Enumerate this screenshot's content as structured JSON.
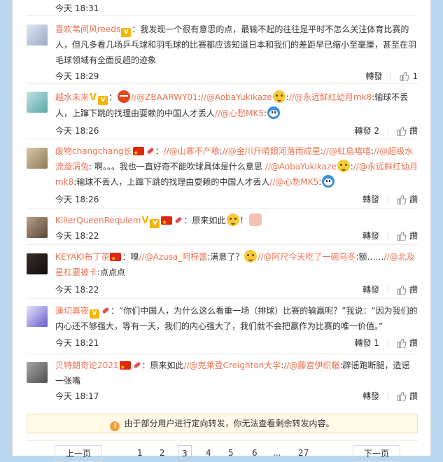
{
  "top": {
    "time": "今天 18:31"
  },
  "labels": {
    "repost": "轉發",
    "like_icon": "thumbs-up-icon"
  },
  "comments": [
    {
      "user": "喜欢苇间风reeds",
      "text": "：我发现一个很有意思的点，最输不起的往往是平时不怎么关注体育比赛的人，但凡多看几场乒乓球和羽毛球的比赛都应该知道日本和我们的差距早已缩小至毫厘，甚至在羽毛球领域有全面反超的迹象",
      "time": "今天 18:29",
      "repost": "轉發",
      "likes": "1"
    },
    {
      "user": "越水未来",
      "p1": "：",
      "m1": "//@ZBAARWY01",
      "p2": ":",
      "m2": "//@AobaYukikaze",
      "p3": ":",
      "m3": "//@永远鲜红幼月mk8",
      "p4": ":输球不丢人，上蹿下跳的找理由耍赖的中国人才丢人",
      "m4": "//@心愁MK5",
      "p5": ":",
      "time": "今天 18:26",
      "repost": "轉發 2",
      "likes": "讚"
    },
    {
      "user": "废物changchang长",
      "p1": "：",
      "m1": "//@山寨不产粮",
      "p2": ":",
      "m2": "//@金川升晴銀河落雨成星",
      "p3": ":",
      "m3": "//@虹島嘻嘻",
      "p4": ":",
      "m4": "//@超级水流漩涡兔",
      "p5": ": 啊。。。我也一直好奇不能吹球具体是什么意思 ",
      "m5": "//@AobaYukikaze",
      "p6": ":",
      "m6": "//@永远鲜红幼月mk8",
      "p7": ":输球不丢人，上蹿下跳的找理由耍赖的中国人才丢人",
      "m7": "//@心愁MK5",
      "p8": ":",
      "time": "今天 18:26",
      "repost": "轉發",
      "likes": "讚"
    },
    {
      "user": "KillerQueenRequiem",
      "text": "：原来如此",
      "tail": "！",
      "time": "今天 18:22",
      "repost": "轉發",
      "likes": "讚"
    },
    {
      "user": "KEYAKI布丁茶",
      "p1": "：嗅",
      "m1": "//@Azusa_阿梓蕾",
      "p2": ":满意了？",
      "m2": "//@阿尺今天吃了一碗乌冬",
      "p3": ":额……",
      "m3": "//@北及星杠要被卡",
      "p4": ":点点点",
      "time": "今天 18:22",
      "repost": "轉發",
      "likes": "讚"
    },
    {
      "user": "蓮切真夜",
      "text": "：“你们中国人，为什么这么看重一场（排球）比赛的输赢呢？”我说：“因为我们的内心还不够强大，等有一天，我们的内心强大了，我们就不会把赢作为比赛的唯一价值。”",
      "time": "今天 18:21",
      "repost": "轉發 1",
      "likes": "讚"
    },
    {
      "user": "贝特朗奇论2021",
      "p1": "：原来如此",
      "m1": "//@克莱登Creighton大学",
      "p2": ":",
      "m2": "//@藤宫伊织輶",
      "p3": ":辟谣跑断腿，造谣一张嘴",
      "time": "今天 18:17",
      "repost": "轉發",
      "likes": "讚"
    }
  ],
  "notice": {
    "text": "由于部分用户进行定向转发，你无法查看剩余转发内容。"
  },
  "pager": {
    "prev": "上一页",
    "p1": "1",
    "p2": "2",
    "p3": "3",
    "p4": "4",
    "p5": "5",
    "p6": "6",
    "ellipsis": "...",
    "p27": "27",
    "next": "下一页"
  },
  "colors": {
    "accent": "#eb7350",
    "background": "#b9d7ee",
    "notice_bg": "#fff9e8"
  }
}
